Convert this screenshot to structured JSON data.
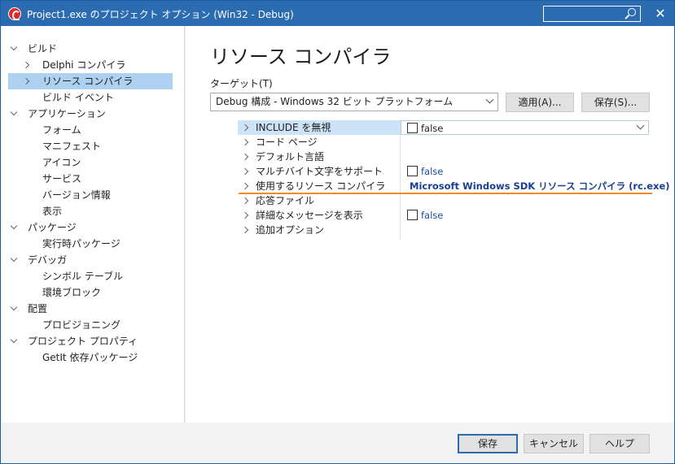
{
  "window": {
    "title": "Project1.exe のプロジェクト オプション  (Win32 - Debug)",
    "close_glyph": "✕"
  },
  "tree": {
    "items": [
      {
        "label": "ビルド",
        "level": 0,
        "toggle": "down"
      },
      {
        "label": "Delphi コンパイラ",
        "level": 1,
        "toggle": "right"
      },
      {
        "label": "リソース コンパイラ",
        "level": 1,
        "toggle": "right",
        "selected": true
      },
      {
        "label": "ビルド イベント",
        "level": 1,
        "toggle": "none"
      },
      {
        "label": "アプリケーション",
        "level": 0,
        "toggle": "down"
      },
      {
        "label": "フォーム",
        "level": 1,
        "toggle": "none"
      },
      {
        "label": "マニフェスト",
        "level": 1,
        "toggle": "none"
      },
      {
        "label": "アイコン",
        "level": 1,
        "toggle": "none"
      },
      {
        "label": "サービス",
        "level": 1,
        "toggle": "none"
      },
      {
        "label": "バージョン情報",
        "level": 1,
        "toggle": "none"
      },
      {
        "label": "表示",
        "level": 1,
        "toggle": "none"
      },
      {
        "label": "パッケージ",
        "level": 0,
        "toggle": "down"
      },
      {
        "label": "実行時パッケージ",
        "level": 1,
        "toggle": "none"
      },
      {
        "label": "デバッガ",
        "level": 0,
        "toggle": "down"
      },
      {
        "label": "シンボル テーブル",
        "level": 1,
        "toggle": "none"
      },
      {
        "label": "環境ブロック",
        "level": 1,
        "toggle": "none"
      },
      {
        "label": "配置",
        "level": 0,
        "toggle": "down"
      },
      {
        "label": "プロビジョニング",
        "level": 1,
        "toggle": "none"
      },
      {
        "label": "プロジェクト プロパティ",
        "level": 0,
        "toggle": "down"
      },
      {
        "label": "GetIt 依存パッケージ",
        "level": 1,
        "toggle": "none"
      }
    ]
  },
  "main": {
    "page_title": "リソース コンパイラ",
    "target_label": "ターゲット(T)",
    "target_value": "Debug 構成 - Windows 32 ビット プラットフォーム",
    "apply_button": "適用(A)...",
    "save_target_button": "保存(S)..."
  },
  "properties": [
    {
      "name": "INCLUDE を無視",
      "value": "false",
      "kind": "checkbox-dropdown",
      "selected": true
    },
    {
      "name": "コード ページ",
      "value": "",
      "kind": "none"
    },
    {
      "name": "デフォルト言語",
      "value": "",
      "kind": "none"
    },
    {
      "name": "マルチバイト文字をサポート",
      "value": "false",
      "kind": "checkbox"
    },
    {
      "name": "使用するリソース コンパイラ",
      "value": "Microsoft Windows SDK リソース コンパイラ (rc.exe)",
      "kind": "bold"
    },
    {
      "name": "応答ファイル",
      "value": "",
      "kind": "none"
    },
    {
      "name": "詳細なメッセージを表示",
      "value": "false",
      "kind": "checkbox"
    },
    {
      "name": "追加オプション",
      "value": "",
      "kind": "none"
    }
  ],
  "footer": {
    "save_button": "保存",
    "cancel_button": "キャンセル",
    "help_button": "ヘルプ"
  },
  "colors": {
    "titlebar": "#2b6cb0",
    "tree_selection": "#aed1f1",
    "row_selection": "#cde3f7",
    "accent_line": "#f08b2e",
    "value_blue": "#1a4da1"
  }
}
